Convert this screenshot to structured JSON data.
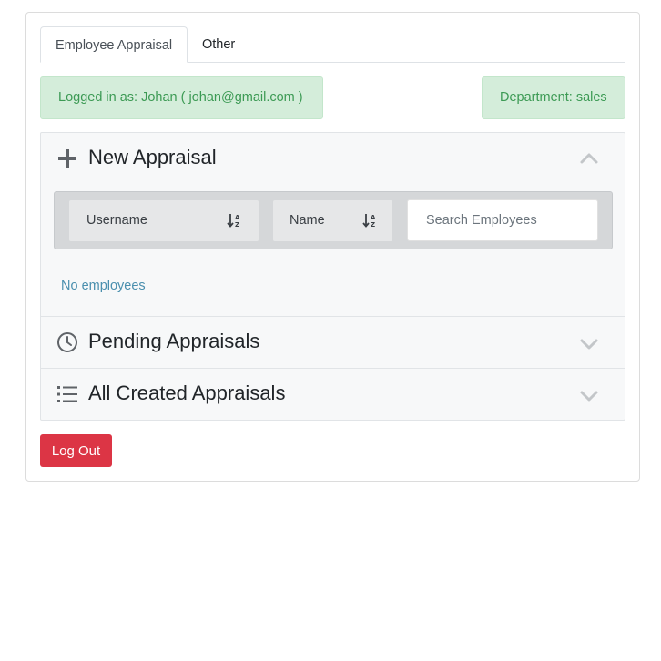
{
  "tabs": [
    {
      "label": "Employee Appraisal",
      "active": true
    },
    {
      "label": "Other",
      "active": false
    }
  ],
  "alerts": {
    "user": "Logged in as: Johan ( johan@gmail.com )",
    "department": "Department: sales"
  },
  "sections": {
    "new_appraisal": {
      "title": "New Appraisal",
      "icon": "plus-icon",
      "expanded": true
    },
    "pending": {
      "title": "Pending Appraisals",
      "icon": "clock-icon",
      "expanded": false
    },
    "all_created": {
      "title": "All Created Appraisals",
      "icon": "list-icon",
      "expanded": false
    }
  },
  "filters": {
    "username_label": "Username",
    "name_label": "Name",
    "search_placeholder": "Search Employees"
  },
  "empty_message": "No employees",
  "logout_label": "Log Out",
  "colors": {
    "success_bg": "#d4edda",
    "success_text": "#3c9a54",
    "danger": "#dc3545",
    "link": "#4a8fae"
  }
}
